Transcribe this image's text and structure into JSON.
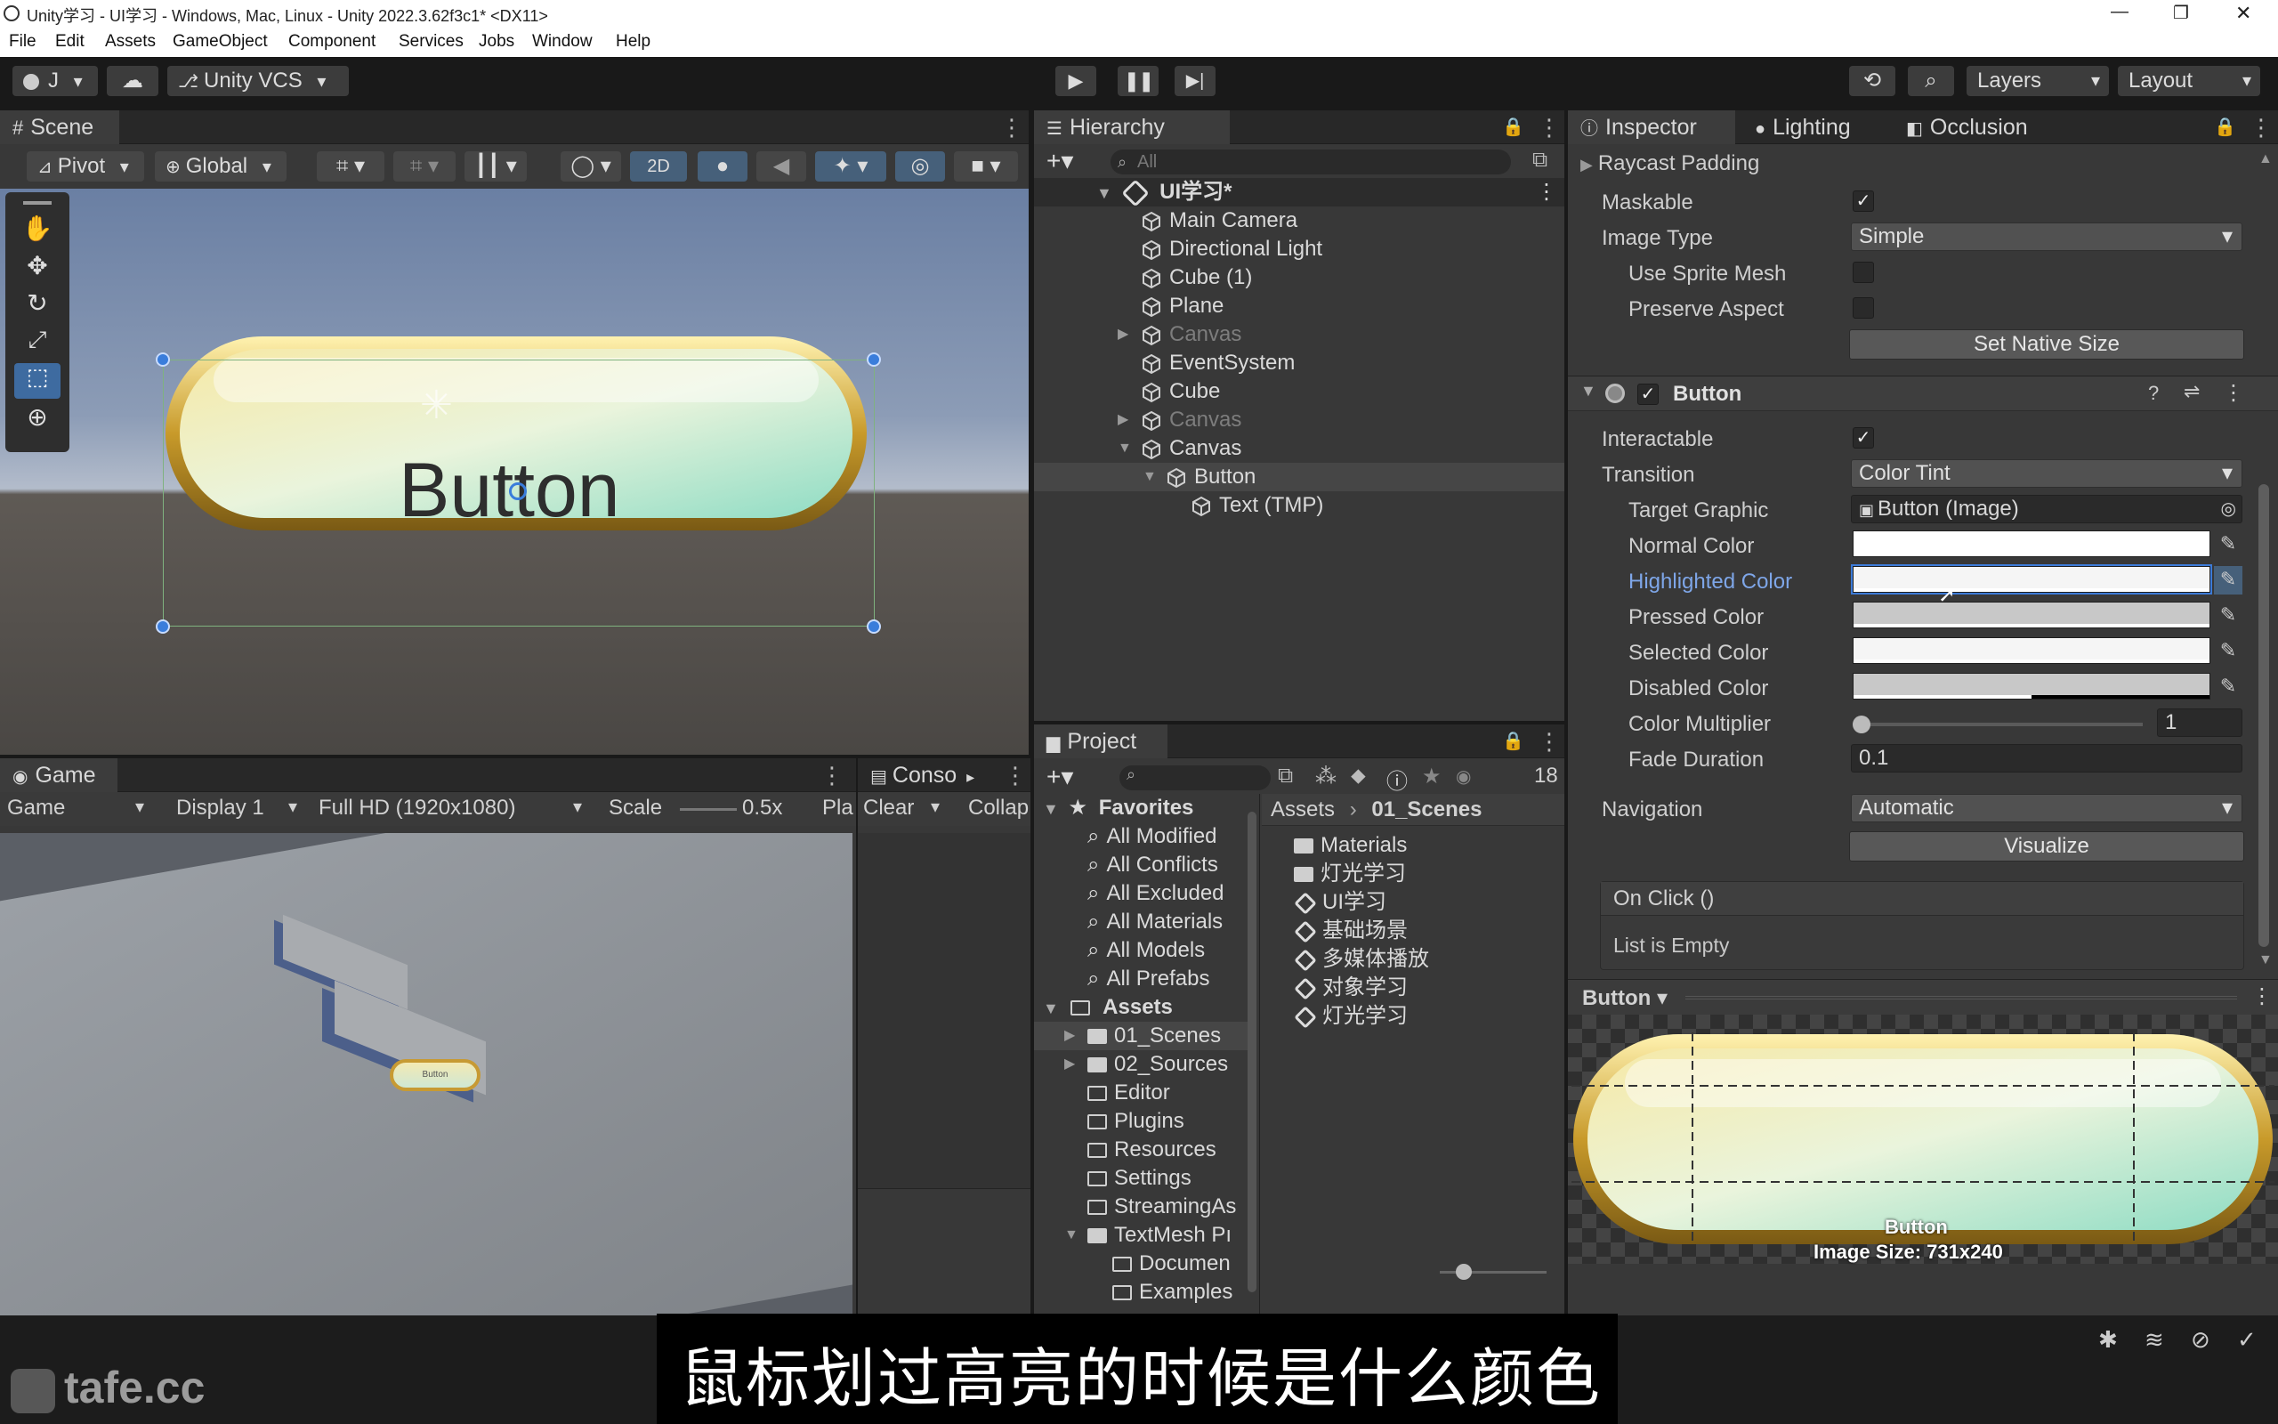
{
  "window": {
    "title": "Unity学习 - UI学习 - Windows, Mac, Linux - Unity 2022.3.62f3c1* <DX11>",
    "controls": [
      "—",
      "❐",
      "✕"
    ]
  },
  "menu": [
    "File",
    "Edit",
    "Assets",
    "GameObject",
    "Component",
    "Services",
    "Jobs",
    "Window",
    "Help"
  ],
  "toolbar": {
    "account": "J",
    "vcs": "Unity VCS",
    "layers": "Layers",
    "layout": "Layout"
  },
  "scene": {
    "tab": "Scene",
    "pivot": "Pivot",
    "global": "Global",
    "mode_2d": "2D",
    "button_text": "Button"
  },
  "game": {
    "tab": "Game",
    "console_tab": "Conso",
    "game_dropdown": "Game",
    "display": "Display 1",
    "resolution": "Full HD (1920x1080)",
    "scale_label": "Scale",
    "scale_value": "0.5x",
    "play_label": "Pla",
    "clear": "Clear",
    "collapse": "Collap",
    "mini_button_text": "Button"
  },
  "hierarchy": {
    "tab": "Hierarchy",
    "search_placeholder": "All",
    "scene_name": "UI学习*",
    "items": [
      {
        "label": "Main Camera",
        "dim": false
      },
      {
        "label": "Directional Light",
        "dim": false
      },
      {
        "label": "Cube (1)",
        "dim": false
      },
      {
        "label": "Plane",
        "dim": false
      },
      {
        "label": "Canvas",
        "dim": true
      },
      {
        "label": "EventSystem",
        "dim": false
      },
      {
        "label": "Cube",
        "dim": false
      },
      {
        "label": "Canvas",
        "dim": true
      },
      {
        "label": "Canvas",
        "dim": false
      },
      {
        "label": "Button",
        "dim": false
      },
      {
        "label": "Text (TMP)",
        "dim": false
      }
    ]
  },
  "project": {
    "tab": "Project",
    "hidden_count": "18",
    "favorites_label": "Favorites",
    "favorites": [
      "All Modified",
      "All Conflicts",
      "All Excluded",
      "All Materials",
      "All Models",
      "All Prefabs"
    ],
    "assets_label": "Assets",
    "tree": [
      "01_Scenes",
      "02_Sources",
      "Editor",
      "Plugins",
      "Resources",
      "Settings",
      "StreamingAs",
      "TextMesh Pı",
      "Documen",
      "Examples"
    ],
    "breadcrumb": [
      "Assets",
      "01_Scenes"
    ],
    "files": [
      {
        "label": "Materials",
        "kind": "folder"
      },
      {
        "label": "灯光学习",
        "kind": "folder"
      },
      {
        "label": "UI学习",
        "kind": "scene"
      },
      {
        "label": "基础场景",
        "kind": "scene"
      },
      {
        "label": "多媒体播放",
        "kind": "scene"
      },
      {
        "label": "对象学习",
        "kind": "scene"
      },
      {
        "label": "灯光学习",
        "kind": "scene"
      }
    ]
  },
  "inspector": {
    "tabs": [
      "Inspector",
      "Lighting",
      "Occlusion"
    ],
    "raycast_padding": "Raycast Padding",
    "maskable": "Maskable",
    "image_type_label": "Image Type",
    "image_type_value": "Simple",
    "use_sprite_mesh": "Use Sprite Mesh",
    "preserve_aspect": "Preserve Aspect",
    "set_native_size": "Set Native Size",
    "button_component": "Button",
    "interactable": "Interactable",
    "transition_label": "Transition",
    "transition_value": "Color Tint",
    "target_graphic_label": "Target Graphic",
    "target_graphic_value": "Button (Image)",
    "colors": [
      {
        "label": "Normal Color",
        "hex": "#ffffff",
        "alpha": 1.0,
        "highlight": false
      },
      {
        "label": "Highlighted Color",
        "hex": "#f5f5f5",
        "alpha": 1.0,
        "highlight": true
      },
      {
        "label": "Pressed Color",
        "hex": "#c8c8c8",
        "alpha": 1.0,
        "highlight": false
      },
      {
        "label": "Selected Color",
        "hex": "#f5f5f5",
        "alpha": 1.0,
        "highlight": false
      },
      {
        "label": "Disabled Color",
        "hex": "#c8c8c8",
        "alpha": 0.5,
        "highlight": false
      }
    ],
    "color_multiplier_label": "Color Multiplier",
    "color_multiplier_value": "1",
    "fade_duration_label": "Fade Duration",
    "fade_duration_value": "0.1",
    "navigation_label": "Navigation",
    "navigation_value": "Automatic",
    "visualize": "Visualize",
    "on_click": "On Click ()",
    "list_empty": "List is Empty",
    "preview_dropdown": "Button",
    "preview_name": "Button",
    "preview_size": "Image Size: 731x240"
  },
  "subtitle": "鼠标划过高亮的时候是什么颜色",
  "watermark": "tafe.cc"
}
